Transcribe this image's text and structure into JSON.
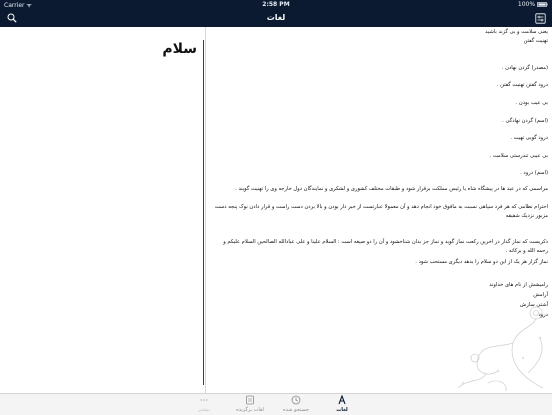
{
  "status": {
    "carrier": "Carrier ᯤ",
    "time": "2:58 PM",
    "battery": "100%"
  },
  "nav": {
    "title": "لغات",
    "search_icon": "search-icon",
    "settings_icon": "settings-icon"
  },
  "entry": {
    "word": "سلام",
    "lines": [
      "یعنی سلامت و بی گزند باشید",
      "تهنیت گفتن",
      "(مصدر) گردن نهادن .",
      "درود گفتن تهنیت گفتن .",
      "بی عیب بودن .",
      "(اسم) گردن نهادگی .",
      "درود گویی تهیت .",
      "بی عیبی تندرستی سلامت .",
      "(اسم) درود ."
    ],
    "paragraphs": [
      "مراسمی که در عید ها در پیشگاه شاه یا رئیس مملکت برقرار شود و طبقات مختلف کشوری و لشکری و نمایندگان دول خارجه وی را تهنیت گویند .",
      "احترام نظامی که هر فرد سپاهی نسبت به مافوق خود انجام دهد و آن معمولا عبارتست از خبر دار بودن و بالا بردن دست راست و قرار دادن نوک پنجه دست مزبور نزدیک شقیقه",
      "ذکریست که نماز گذار در اخرین رکعت نماز گوید و نماز جز بدان شناخشود و آن را دو صیغه است : السلام علینا و علی عبادالله الصالحین السلام علیکم و رحمه الله و برکاته .",
      "نماز گزار هر یک از این دو سلام را بدهد دیگری مستحب شود ."
    ],
    "closing": [
      "رامیشش از نام های خداوند",
      "آرامش",
      "آشتی سازش",
      "درود"
    ]
  },
  "tabs": [
    {
      "label": "لغات",
      "icon": "dictionary-icon",
      "active": true
    },
    {
      "label": "جستجو شده",
      "icon": "history-icon",
      "active": false
    },
    {
      "label": "لغات برگزیده",
      "icon": "favorites-icon",
      "active": false
    },
    {
      "label": "بیشتر",
      "icon": "more-icon",
      "active": false
    }
  ]
}
